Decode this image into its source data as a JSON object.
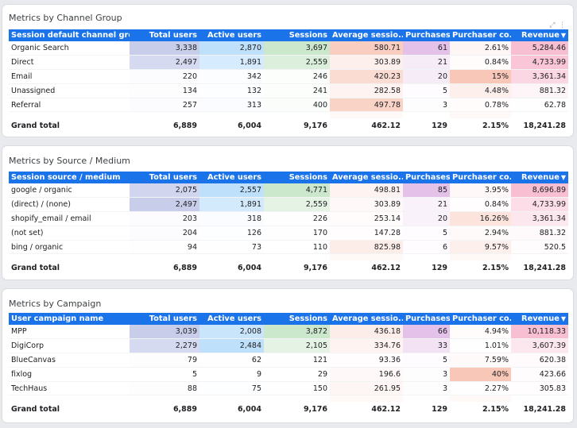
{
  "columns_common": [
    "Total users",
    "Active users",
    "Sessions",
    "Average sessio...",
    "Purchases",
    "Purchaser co...",
    "Revenue"
  ],
  "sort_indicator": "▼",
  "tool_icons": "⤢ ⋮",
  "colors": {
    "header": "#1a73e8",
    "total_users": "#c5cae9",
    "active_users": "#bbdefb",
    "sessions": "#c8e6c9",
    "avg_session": "#f8c4b4",
    "purchases": "#e1bee7",
    "purchaser_conv": "#f8c4b4",
    "revenue": "#f8bbd0"
  },
  "tables": [
    {
      "title": "Metrics by Channel Group",
      "first_col": "Session default channel gro...",
      "rows": [
        [
          "Organic Search",
          "3,338",
          "2,870",
          "3,697",
          "580.71",
          "61",
          "2.61%",
          "5,284.46"
        ],
        [
          "Direct",
          "2,497",
          "1,891",
          "2,559",
          "303.89",
          "21",
          "0.84%",
          "4,733.99"
        ],
        [
          "Email",
          "220",
          "342",
          "246",
          "420.23",
          "20",
          "15%",
          "3,361.34"
        ],
        [
          "Unassigned",
          "134",
          "132",
          "241",
          "282.58",
          "5",
          "4.48%",
          "881.32"
        ],
        [
          "Referral",
          "257",
          "313",
          "400",
          "497.78",
          "3",
          "0.78%",
          "62.78"
        ]
      ],
      "total": [
        "Grand total",
        "6,889",
        "6,004",
        "9,176",
        "462.12",
        "129",
        "2.15%",
        "18,241.28"
      ],
      "intensity": [
        [
          0.95,
          0.95,
          0.95,
          0.85,
          0.95,
          0.15,
          0.95
        ],
        [
          0.7,
          0.6,
          0.65,
          0.25,
          0.3,
          0.05,
          0.85
        ],
        [
          0.05,
          0.05,
          0.05,
          0.6,
          0.3,
          0.95,
          0.6
        ],
        [
          0.03,
          0.03,
          0.05,
          0.2,
          0.05,
          0.25,
          0.15
        ],
        [
          0.06,
          0.08,
          0.1,
          0.75,
          0.03,
          0.05,
          0.02
        ]
      ]
    },
    {
      "title": "Metrics by Source / Medium",
      "first_col": "Session source / medium",
      "rows": [
        [
          "google / organic",
          "2,075",
          "2,557",
          "4,771",
          "498.81",
          "85",
          "3.95%",
          "8,696.89"
        ],
        [
          "(direct) / (none)",
          "2,497",
          "1,891",
          "2,559",
          "303.89",
          "21",
          "0.84%",
          "4,733.99"
        ],
        [
          "shopify_email / email",
          "203",
          "318",
          "226",
          "253.14",
          "20",
          "16.26%",
          "3,361.34"
        ],
        [
          "(not set)",
          "204",
          "126",
          "170",
          "147.28",
          "5",
          "2.94%",
          "881.32"
        ],
        [
          "bing / organic",
          "94",
          "73",
          "110",
          "825.98",
          "6",
          "9.57%",
          "520.5"
        ]
      ],
      "total": [
        "Grand total",
        "6,889",
        "6,004",
        "9,176",
        "462.12",
        "129",
        "2.15%",
        "18,241.28"
      ],
      "intensity": [
        [
          0.8,
          0.95,
          0.95,
          0.2,
          0.95,
          0.1,
          0.95
        ],
        [
          0.95,
          0.65,
          0.5,
          0.1,
          0.2,
          0.03,
          0.5
        ],
        [
          0.05,
          0.08,
          0.04,
          0.05,
          0.2,
          0.45,
          0.35
        ],
        [
          0.05,
          0.03,
          0.03,
          0.03,
          0.05,
          0.08,
          0.08
        ],
        [
          0.02,
          0.02,
          0.02,
          0.3,
          0.05,
          0.25,
          0.05
        ]
      ]
    },
    {
      "title": "Metrics by Campaign",
      "first_col": "User campaign name",
      "rows": [
        [
          "MPP",
          "3,039",
          "2,008",
          "3,872",
          "436.18",
          "66",
          "4.94%",
          "10,118.33"
        ],
        [
          "DigiCorp",
          "2,279",
          "2,484",
          "2,105",
          "334.76",
          "33",
          "1.01%",
          "3,607.39"
        ],
        [
          "BlueCanvas",
          "79",
          "62",
          "121",
          "93.36",
          "5",
          "7.59%",
          "620.38"
        ],
        [
          "fixlog",
          "5",
          "9",
          "29",
          "196.6",
          "3",
          "40%",
          "423.66"
        ],
        [
          "TechHaus",
          "88",
          "75",
          "150",
          "261.95",
          "3",
          "2.27%",
          "305.83"
        ]
      ],
      "total": [
        "Grand total",
        "6,889",
        "6,004",
        "9,176",
        "462.12",
        "129",
        "2.15%",
        "18,241.28"
      ],
      "intensity": [
        [
          0.95,
          0.8,
          0.95,
          0.3,
          0.95,
          0.05,
          0.95
        ],
        [
          0.7,
          0.95,
          0.5,
          0.2,
          0.45,
          0.02,
          0.35
        ],
        [
          0.03,
          0.02,
          0.03,
          0.03,
          0.05,
          0.08,
          0.06
        ],
        [
          0.0,
          0.0,
          0.01,
          0.1,
          0.03,
          0.95,
          0.04
        ],
        [
          0.03,
          0.03,
          0.04,
          0.15,
          0.03,
          0.02,
          0.03
        ]
      ]
    }
  ]
}
